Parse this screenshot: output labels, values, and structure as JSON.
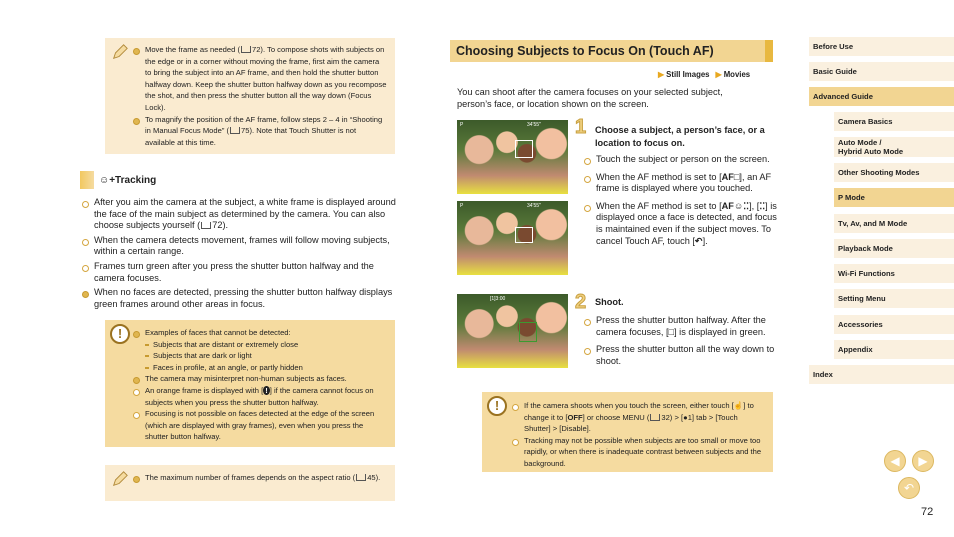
{
  "left": {
    "note1": [
      {
        "pre": "Move the frame as needed (",
        "post": "72). To compose shots with subjects on the edge or in a corner without moving the frame, first aim the camera to bring the subject into an AF frame, and then hold the shutter button halfway down. Keep the shutter button halfway down as you recompose the shot, and then press the shutter button all the way down (Focus Lock)."
      },
      {
        "pre": "To magnify the position of the AF frame, follow steps 2 – 4 in “Shooting in Manual Focus Mode” (",
        "post": "75). Note that Touch Shutter is not available at this time."
      }
    ],
    "section_title": "+Tracking",
    "bullets": [
      {
        "pre": "After you aim the camera at the subject, a white frame is displayed around the face of the main subject as determined by the camera. You can also choose subjects yourself (",
        "post": "72)."
      },
      {
        "pre": "When the camera detects movement, frames will follow moving subjects, within a certain range.",
        "post": ""
      },
      {
        "pre": "Frames turn green after you press the shutter button halfway and the camera focuses.",
        "post": ""
      },
      {
        "pre": "When no faces are detected, pressing the shutter button halfway displays green frames around other areas in focus.",
        "post": ""
      }
    ],
    "warn": {
      "intro": "Examples of faces that cannot be detected:",
      "subs": [
        "Subjects that are distant or extremely close",
        "Subjects that are dark or light",
        "Faces in profile, at an angle, or partly hidden"
      ],
      "b2": "The camera may misinterpret non-human subjects as faces.",
      "b3pre": "An orange frame is displayed with [",
      "b3post": "] if the camera cannot focus on subjects when you press the shutter button halfway.",
      "b4": "Focusing is not possible on faces detected at the edge of the screen (which are displayed with gray frames), even when you press the shutter button halfway."
    },
    "note2": {
      "pre": "The maximum number of frames depends on the aspect ratio (",
      "post": "45)."
    }
  },
  "main": {
    "title": "Choosing Subjects to Focus On (Touch AF)",
    "modes": [
      "Still Images",
      "Movies"
    ],
    "intro": "You can shoot after the camera focuses on your selected subject, person’s face, or location shown on the screen.",
    "step1": {
      "num": "1",
      "title": "Choose a subject, a person’s face, or a location to focus on.",
      "b1": "Touch the subject or person on the screen.",
      "b2pre": "When the AF method is set to [",
      "b2icon": "AF□",
      "b2post": "], an AF frame is displayed where you touched.",
      "b3pre": "When the AF method is set to [",
      "b3icon": "AF☺⁚⁚",
      "b3mid": "], [",
      "b3icon2": "⁚⁚",
      "b3post": "] is displayed once a face is detected, and focus is maintained even if the subject moves. To cancel Touch AF, touch [",
      "b3icon3": "↶",
      "b3end": "]."
    },
    "step2": {
      "num": "2",
      "title": "Shoot.",
      "b1pre": "Press the shutter button halfway. After the camera focuses, [",
      "b1icon": "□",
      "b1post": "] is displayed in green.",
      "b2": "Press the shutter button all the way down to shoot."
    },
    "photo_overlay": [
      "P",
      "34'55\"",
      "[1]3:00"
    ],
    "warn": {
      "b1": "If the camera shoots when you touch the screen, either touch [",
      "b1i": "☝",
      "b1b": "] to change it to [",
      "b1i2": "OFF",
      "b1c": "] or choose MENU (",
      "b1d": "32) > [",
      "b1i3": "●",
      "b1e": "1] tab > [Touch Shutter] > [Disable].",
      "b2": "Tracking may not be possible when subjects are too small or move too rapidly, or when there is inadequate contrast between subjects and the background."
    }
  },
  "sidebar": {
    "items": [
      {
        "label": "Before Use"
      },
      {
        "label": "Basic Guide"
      },
      {
        "label": "Advanced Guide",
        "selected": true
      },
      {
        "label": "Camera Basics"
      },
      {
        "label": "Auto Mode /\nHybrid Auto Mode"
      },
      {
        "label": "Other Shooting Modes"
      },
      {
        "label": "P Mode",
        "selected": true
      },
      {
        "label": "Tv, Av, and M Mode"
      },
      {
        "label": "Playback Mode"
      },
      {
        "label": "Wi-Fi Functions"
      },
      {
        "label": "Setting Menu"
      },
      {
        "label": "Accessories"
      },
      {
        "label": "Appendix"
      },
      {
        "label": "Index"
      }
    ]
  },
  "footer": {
    "page": "72"
  },
  "colors": {
    "accent": "#f2d592",
    "note": "#faebd0",
    "warn": "#f5dba0"
  }
}
